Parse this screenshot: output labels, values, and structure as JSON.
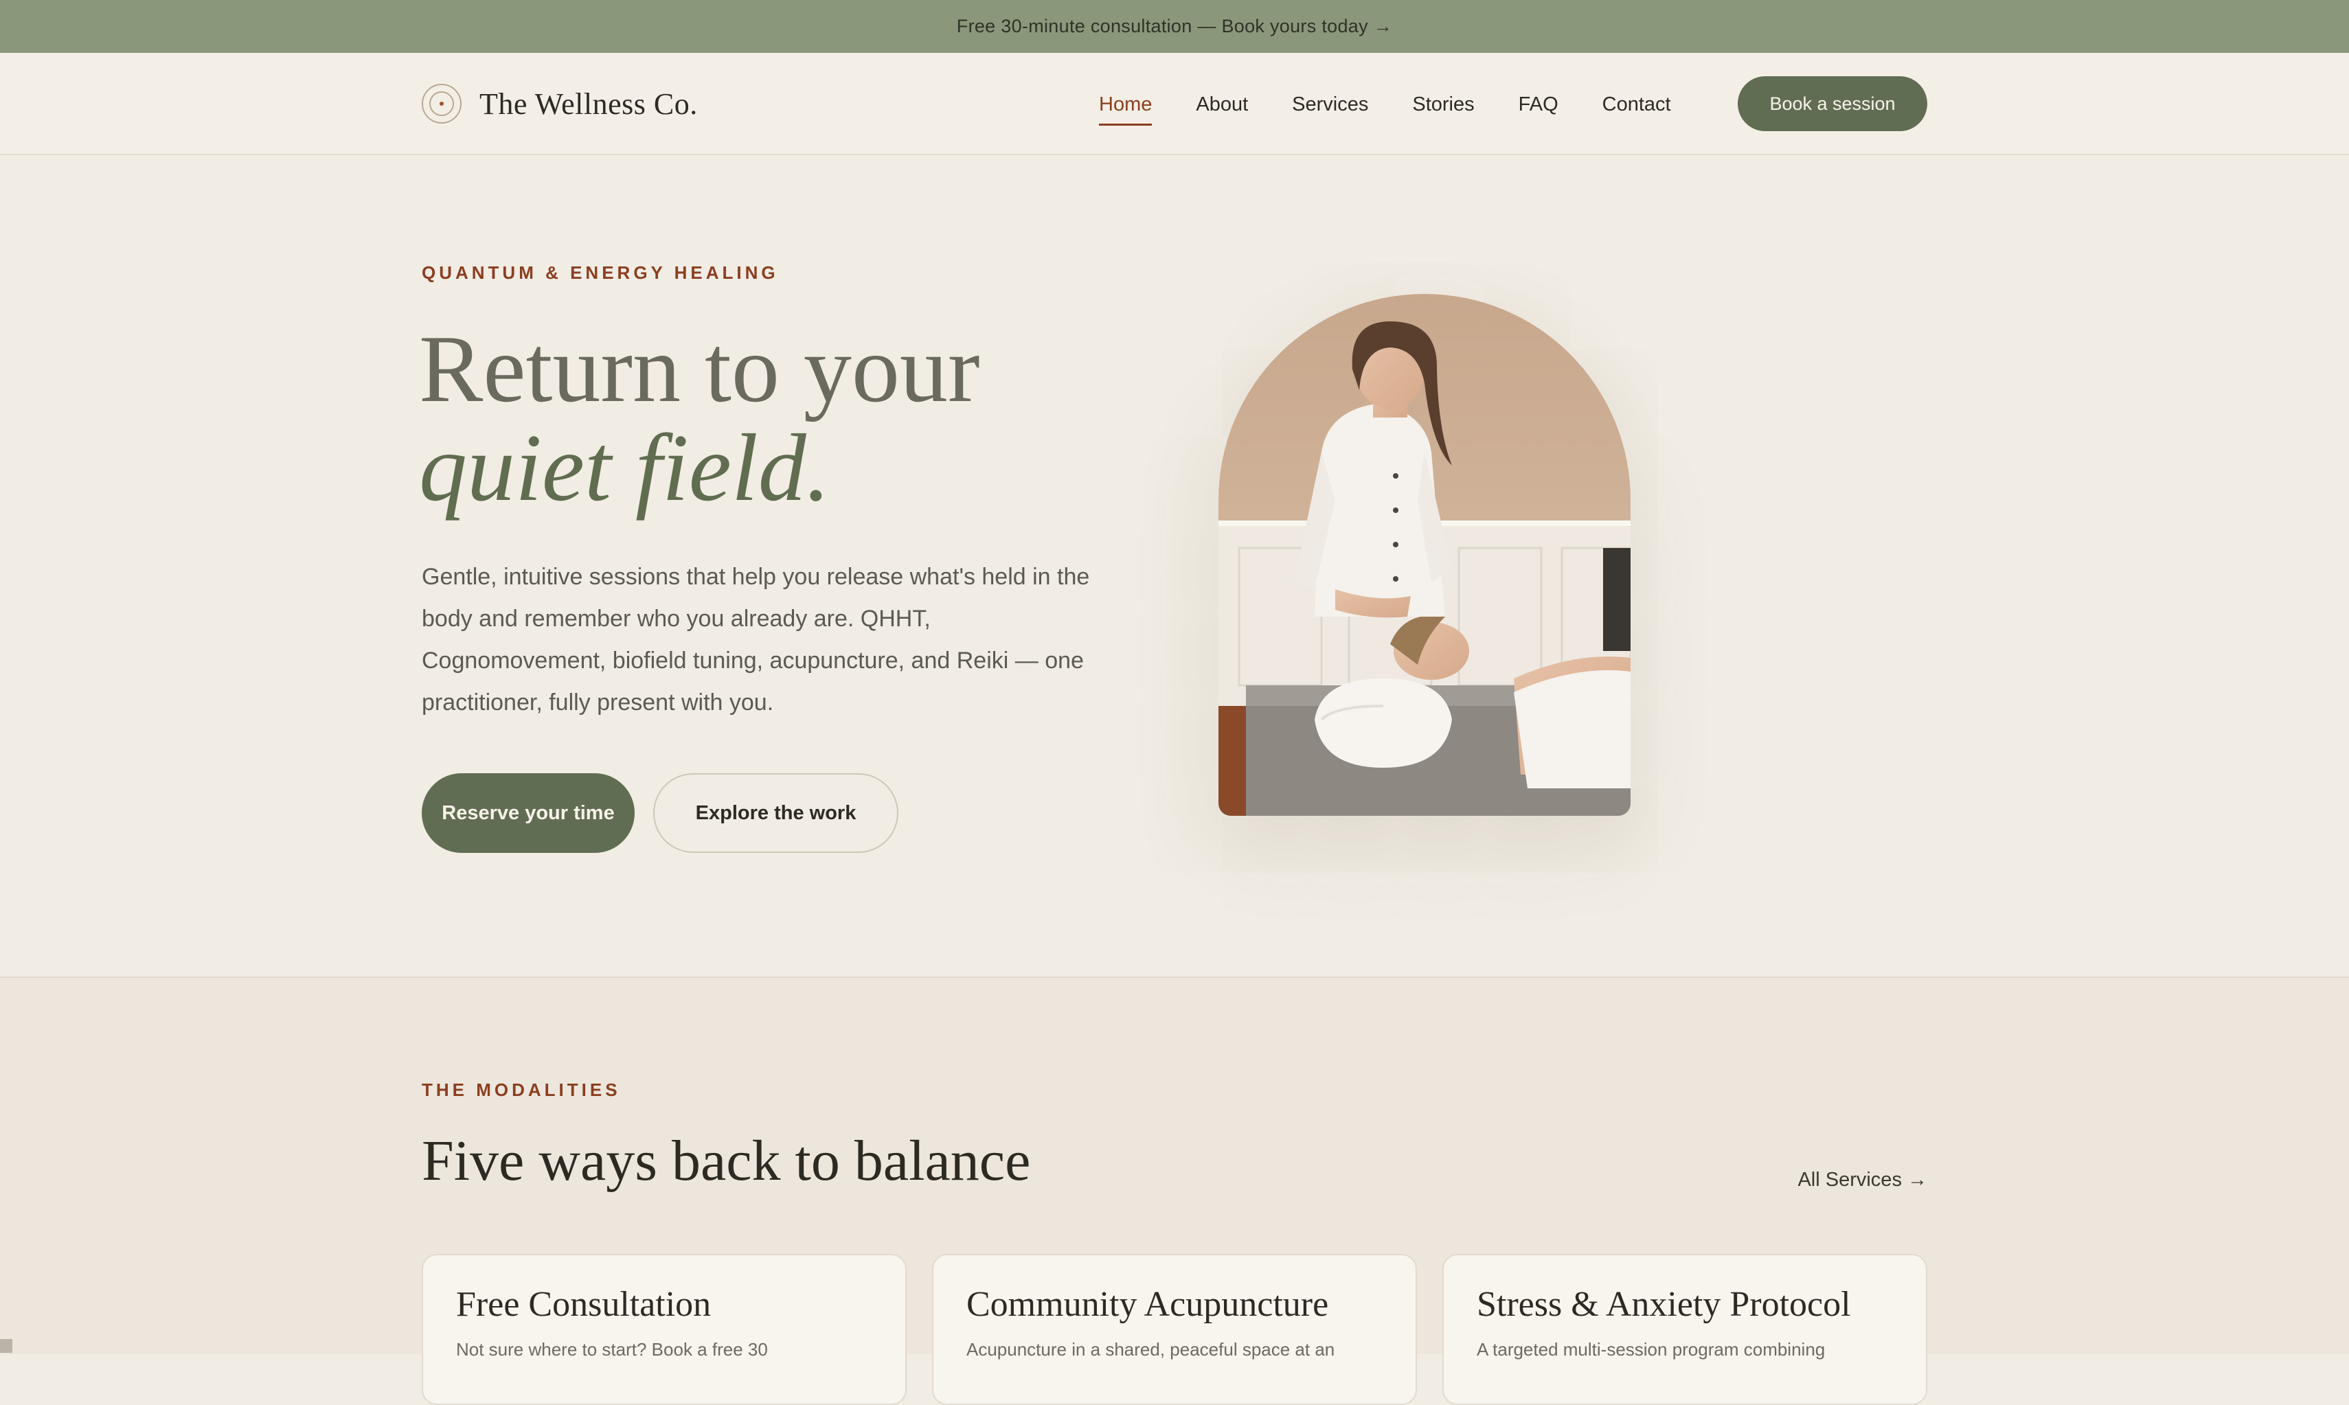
{
  "announcement": {
    "text": "Free 30-minute consultation — Book yours today",
    "arrow": "→"
  },
  "brand": {
    "name": "The Wellness Co."
  },
  "nav": {
    "links": [
      "Home",
      "About",
      "Services",
      "Stories",
      "FAQ",
      "Contact"
    ],
    "active": "Home",
    "cta": "Book a session"
  },
  "hero": {
    "eyebrow": "QUANTUM & ENERGY HEALING",
    "title_line1": "Return to your",
    "title_line2": "quiet field.",
    "description": "Gentle, intuitive sessions that help you release what's held in the body and remember who you already are. QHHT, Cognomovement, biofield tuning, acupuncture, and Reiki — one practitioner, fully present with you.",
    "primary_cta": "Reserve your time",
    "secondary_cta": "Explore the work"
  },
  "modalities": {
    "eyebrow": "THE MODALITIES",
    "title": "Five ways back to balance",
    "link": "All Services →",
    "cards": [
      {
        "title": "Free Consultation",
        "desc": "Not sure where to start? Book a free 30"
      },
      {
        "title": "Community Acupuncture",
        "desc": "Acupuncture in a shared, peaceful space at an"
      },
      {
        "title": "Stress & Anxiety Protocol",
        "desc": "A targeted multi-session program combining"
      }
    ]
  },
  "colors": {
    "announcement_bg": "#8a977b",
    "accent_green": "#616d52",
    "accent_rust": "#8b3e1f",
    "page_bg": "#f1ece4"
  }
}
